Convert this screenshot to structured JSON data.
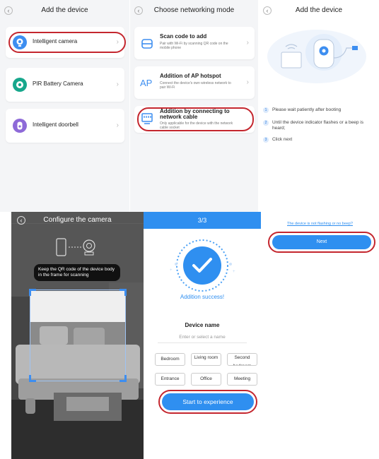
{
  "add_device": {
    "title": "Add the device",
    "items": [
      {
        "label": "Intelligent camera"
      },
      {
        "label": "PIR Battery Camera"
      },
      {
        "label": "Intelligent doorbell"
      }
    ]
  },
  "networking": {
    "title": "Choose networking mode",
    "options": [
      {
        "title": "Scan code to add",
        "desc": "Pair with Wi-Fi by scanning QR code on the mobile phone"
      },
      {
        "title": "Addition of AP hotspot",
        "desc": "Connect the device's own wireless network to pair Wi-Fi"
      },
      {
        "title": "Addition by connecting to network cable",
        "desc": "Only applicable for the device with the network cable socket"
      }
    ],
    "ap_icon_text": "AP"
  },
  "add_device_steps": {
    "title": "Add the device",
    "steps": [
      {
        "num": "1",
        "text": "Please wait patiently after booting"
      },
      {
        "num": "2",
        "text": "Until the device indicator flashes or a beep is heard;"
      },
      {
        "num": "3",
        "text": "Click next"
      }
    ]
  },
  "configure": {
    "title": "Configure the camera",
    "tip": "Keep the QR code of the device body in the frame for scanning"
  },
  "success": {
    "step": "3/3",
    "message": "Addition success!",
    "device_name_label": "Device name",
    "name_placeholder": "Enter or select a name",
    "names": [
      "Bedroom",
      "Living room",
      "Second bedroom",
      "Entrance",
      "Office",
      "Meeting"
    ],
    "start_label": "Start to experience"
  },
  "next_panel": {
    "link": "The device is not flashing or no beep?",
    "next_label": "Next"
  },
  "colors": {
    "highlight": "#c4262e",
    "primary": "#2f8ff0",
    "teal": "#17a78c",
    "purple": "#8e6ad8",
    "blue_icon": "#3d8ef0"
  }
}
